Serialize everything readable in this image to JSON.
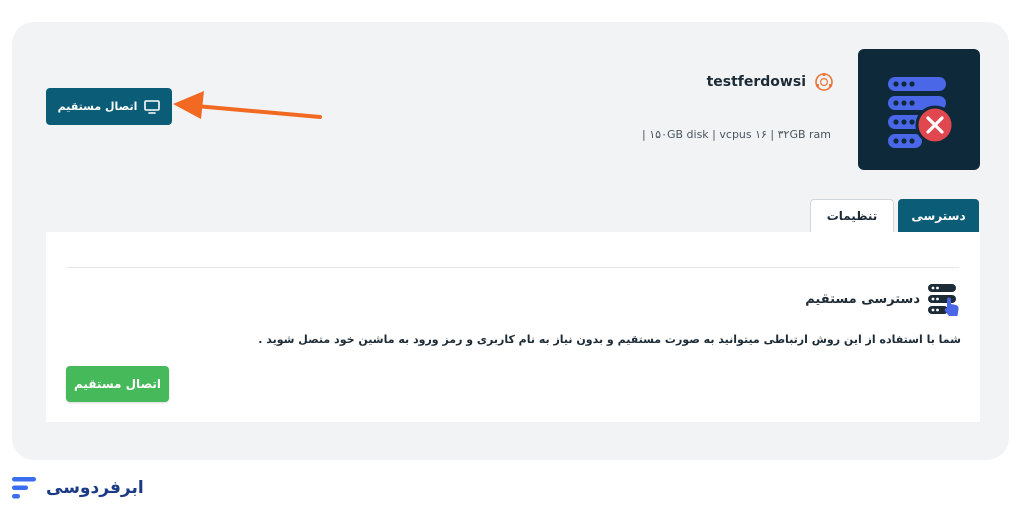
{
  "server": {
    "name": "testferdowsi",
    "specs": "| ۱۵۰GB disk | vcpus ۱۶ | ۳۲GB ram",
    "os_icon": "ubuntu-icon",
    "status_icon": "server-error-icon"
  },
  "actions": {
    "direct_connect_label": "اتصال مستقیم"
  },
  "tabs": [
    {
      "label": "دسترسی",
      "active": true
    },
    {
      "label": "تنظیمات",
      "active": false
    }
  ],
  "access": {
    "title": "دسترسی مستقیم",
    "description": "شما با استفاده از این روش ارتباطی میتوانید به صورت مستقیم و بدون نیاز به نام کاربری و رمز ورود به ماشین خود متصل شوید .",
    "button_label": "اتصال مستقیم"
  },
  "brand": {
    "name": "ابرفردوسی"
  },
  "colors": {
    "primary": "#0b5c77",
    "dark_box": "#0e2a3a",
    "server_icon_blue": "#4a67e8",
    "error_red": "#e0474f",
    "success_green": "#46b95a",
    "arrow_orange": "#f26a21",
    "brand_blue": "#1a3a86"
  }
}
